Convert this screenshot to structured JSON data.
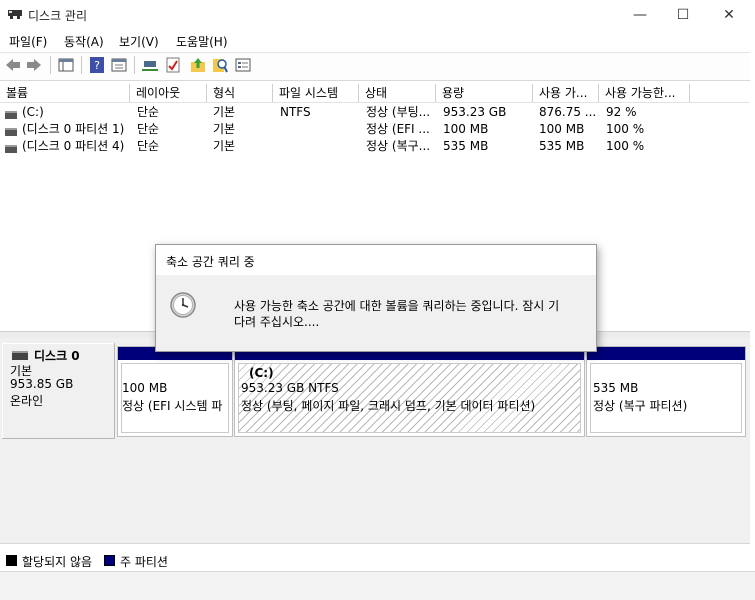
{
  "window": {
    "title": "디스크 관리",
    "minimize_glyph": "—",
    "maximize_glyph": "☐",
    "close_glyph": "✕"
  },
  "menu": [
    "파일(F)",
    "동작(A)",
    "보기(V)",
    "도움말(H)"
  ],
  "toolbar_icons": [
    "back-icon",
    "forward-icon",
    "console-tree-icon",
    "help-icon",
    "properties-icon",
    "connect-icon",
    "check-icon",
    "folder-up-icon",
    "search-icon",
    "details-icon"
  ],
  "list": {
    "columns": [
      "볼륨",
      "레이아웃",
      "형식",
      "파일 시스템",
      "상태",
      "용량",
      "사용 가...",
      "사용 가능한..."
    ],
    "rows": [
      [
        "(C:)",
        "단순",
        "기본",
        "NTFS",
        "정상 (부팅...",
        "953.23 GB",
        "876.75 ...",
        "92 %"
      ],
      [
        "(디스크 0 파티션 1)",
        "단순",
        "기본",
        "",
        "정상 (EFI ...",
        "100 MB",
        "100 MB",
        "100 %"
      ],
      [
        "(디스크 0 파티션 4)",
        "단순",
        "기본",
        "",
        "정상 (복구...",
        "535 MB",
        "535 MB",
        "100 %"
      ]
    ]
  },
  "disk": {
    "name": "디스크 0",
    "type": "기본",
    "size": "953.85 GB",
    "status": "온라인",
    "partitions": [
      {
        "title": "",
        "line1": "100 MB",
        "line2": "정상 (EFI 시스템 파"
      },
      {
        "title": "(C:)",
        "line1": "953.23 GB NTFS",
        "line2": "정상 (부팅, 페이지 파일, 크래시 덤프, 기본 데이터 파티션)"
      },
      {
        "title": "",
        "line1": "535 MB",
        "line2": "정상 (복구 파티션)"
      }
    ]
  },
  "legend": [
    {
      "label": "할당되지 않음",
      "color": "#000000"
    },
    {
      "label": "주 파티션",
      "color": "#00007b"
    }
  ],
  "dialog": {
    "title": "축소 공간 쿼리 중",
    "message_line1": "사용 가능한 축소 공간에 대한 볼륨을 쿼리하는 중입니다. 잠시 기",
    "message_line2": "다려 주십시오...."
  }
}
